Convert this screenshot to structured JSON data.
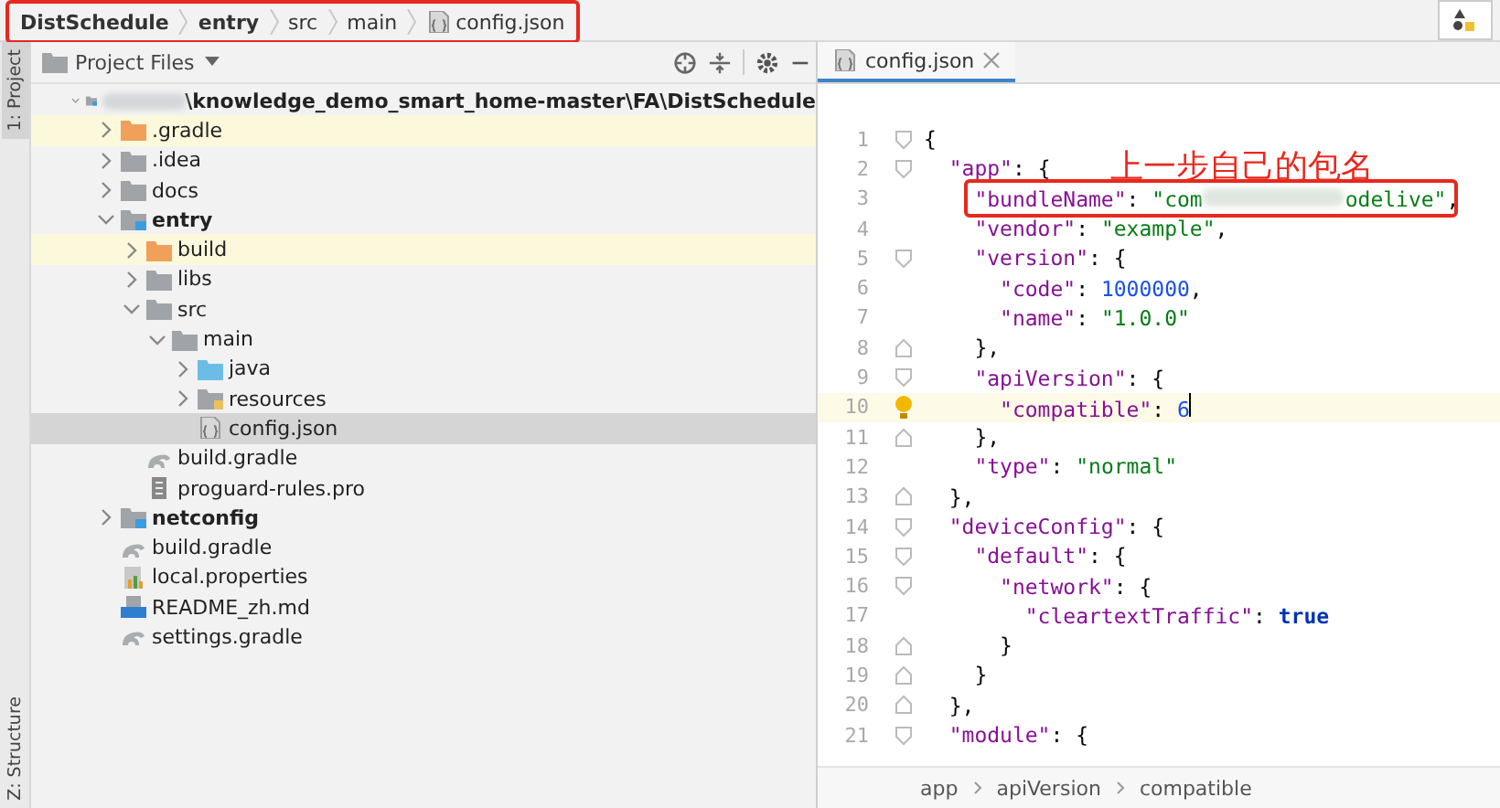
{
  "navbar": {
    "crumbs": [
      {
        "label": "DistSchedule",
        "kind": "module"
      },
      {
        "label": "entry",
        "kind": "module"
      },
      {
        "label": "src",
        "kind": "dir"
      },
      {
        "label": "main",
        "kind": "dir"
      },
      {
        "label": "config.json",
        "kind": "json"
      }
    ]
  },
  "side_tabs": [
    {
      "label": "1: Project",
      "selected": true
    },
    {
      "label": "Z: Structure",
      "selected": false
    }
  ],
  "project": {
    "title": "Project Files",
    "tree": [
      {
        "label": "\\knowledge_demo_smart_home-master\\FA\\DistSchedule",
        "kind": "module",
        "redacted": true,
        "expanded": true,
        "selected": false,
        "highlighted": false,
        "children": [
          {
            "label": ".gradle",
            "kind": "excluded",
            "expanded": false,
            "selected": false,
            "highlighted": true
          },
          {
            "label": ".idea",
            "kind": "folder",
            "expanded": false,
            "selected": false,
            "highlighted": false
          },
          {
            "label": "docs",
            "kind": "folder",
            "expanded": false,
            "selected": false,
            "highlighted": false
          },
          {
            "label": "entry",
            "kind": "module",
            "expanded": true,
            "selected": false,
            "highlighted": false,
            "children": [
              {
                "label": "build",
                "kind": "excluded",
                "expanded": false,
                "selected": false,
                "highlighted": true
              },
              {
                "label": "libs",
                "kind": "folder",
                "expanded": false,
                "selected": false,
                "highlighted": false
              },
              {
                "label": "src",
                "kind": "folder",
                "expanded": true,
                "selected": false,
                "highlighted": false,
                "children": [
                  {
                    "label": "main",
                    "kind": "folder",
                    "expanded": true,
                    "selected": false,
                    "highlighted": false,
                    "children": [
                      {
                        "label": "java",
                        "kind": "source",
                        "expanded": false,
                        "selected": false,
                        "highlighted": false
                      },
                      {
                        "label": "resources",
                        "kind": "resources",
                        "expanded": false,
                        "selected": false,
                        "highlighted": false
                      },
                      {
                        "label": "config.json",
                        "kind": "json",
                        "selected": true,
                        "highlighted": false
                      }
                    ]
                  }
                ]
              },
              {
                "label": "build.gradle",
                "kind": "gradle",
                "selected": false,
                "highlighted": false
              },
              {
                "label": "proguard-rules.pro",
                "kind": "text",
                "selected": false,
                "highlighted": false
              }
            ]
          },
          {
            "label": "netconfig",
            "kind": "module",
            "expanded": false,
            "selected": false,
            "highlighted": false
          },
          {
            "label": "build.gradle",
            "kind": "gradle",
            "selected": false,
            "highlighted": false
          },
          {
            "label": "local.properties",
            "kind": "properties",
            "selected": false,
            "highlighted": false
          },
          {
            "label": "README_zh.md",
            "kind": "markdown",
            "selected": false,
            "highlighted": false
          },
          {
            "label": "settings.gradle",
            "kind": "gradle",
            "selected": false,
            "highlighted": false
          }
        ]
      }
    ]
  },
  "editor": {
    "tabs": [
      {
        "label": "config.json",
        "selected": true
      }
    ],
    "lines": [
      {
        "number": "1",
        "fold_open": true,
        "fold_close": false,
        "current": false,
        "tokens": [
          {
            "kind": "punct",
            "text": "{"
          }
        ]
      },
      {
        "number": "2",
        "fold_open": true,
        "fold_close": false,
        "current": false,
        "tokens": [
          {
            "kind": "key",
            "text": "  \"app\""
          },
          {
            "kind": "punct",
            "text": ": {"
          }
        ]
      },
      {
        "number": "3",
        "fold_open": false,
        "fold_close": false,
        "current": false,
        "tokens": [
          {
            "kind": "key",
            "text": "    \"bundleName\""
          },
          {
            "kind": "punct",
            "text": ": "
          },
          {
            "kind": "str",
            "text": "\"com"
          },
          {
            "kind": "redacted"
          },
          {
            "kind": "str",
            "text": "odelive\""
          },
          {
            "kind": "punct",
            "text": ","
          }
        ]
      },
      {
        "number": "4",
        "fold_open": false,
        "fold_close": false,
        "current": false,
        "tokens": [
          {
            "kind": "key",
            "text": "    \"vendor\""
          },
          {
            "kind": "punct",
            "text": ": "
          },
          {
            "kind": "str",
            "text": "\"example\""
          },
          {
            "kind": "punct",
            "text": ","
          }
        ]
      },
      {
        "number": "5",
        "fold_open": true,
        "fold_close": false,
        "current": false,
        "tokens": [
          {
            "kind": "key",
            "text": "    \"version\""
          },
          {
            "kind": "punct",
            "text": ": {"
          }
        ]
      },
      {
        "number": "6",
        "fold_open": false,
        "fold_close": false,
        "current": false,
        "tokens": [
          {
            "kind": "key",
            "text": "      \"code\""
          },
          {
            "kind": "punct",
            "text": ": "
          },
          {
            "kind": "num",
            "text": "1000000"
          },
          {
            "kind": "punct",
            "text": ","
          }
        ]
      },
      {
        "number": "7",
        "fold_open": false,
        "fold_close": false,
        "current": false,
        "tokens": [
          {
            "kind": "key",
            "text": "      \"name\""
          },
          {
            "kind": "punct",
            "text": ": "
          },
          {
            "kind": "str",
            "text": "\"1.0.0\""
          }
        ]
      },
      {
        "number": "8",
        "fold_open": false,
        "fold_close": true,
        "current": false,
        "tokens": [
          {
            "kind": "punct",
            "text": "    },"
          }
        ]
      },
      {
        "number": "9",
        "fold_open": true,
        "fold_close": false,
        "current": false,
        "tokens": [
          {
            "kind": "key",
            "text": "    \"apiVersion\""
          },
          {
            "kind": "punct",
            "text": ": {"
          }
        ]
      },
      {
        "number": "10",
        "fold_open": false,
        "fold_close": false,
        "current": true,
        "tokens": [
          {
            "kind": "key",
            "text": "      \"compatible\""
          },
          {
            "kind": "punct",
            "text": ": "
          },
          {
            "kind": "num",
            "text": "6"
          }
        ]
      },
      {
        "number": "11",
        "fold_open": false,
        "fold_close": true,
        "current": false,
        "tokens": [
          {
            "kind": "punct",
            "text": "    },"
          }
        ]
      },
      {
        "number": "12",
        "fold_open": false,
        "fold_close": false,
        "current": false,
        "tokens": [
          {
            "kind": "key",
            "text": "    \"type\""
          },
          {
            "kind": "punct",
            "text": ": "
          },
          {
            "kind": "str",
            "text": "\"normal\""
          }
        ]
      },
      {
        "number": "13",
        "fold_open": false,
        "fold_close": true,
        "current": false,
        "tokens": [
          {
            "kind": "punct",
            "text": "  },"
          }
        ]
      },
      {
        "number": "14",
        "fold_open": true,
        "fold_close": false,
        "current": false,
        "tokens": [
          {
            "kind": "key",
            "text": "  \"deviceConfig\""
          },
          {
            "kind": "punct",
            "text": ": {"
          }
        ]
      },
      {
        "number": "15",
        "fold_open": true,
        "fold_close": false,
        "current": false,
        "tokens": [
          {
            "kind": "key",
            "text": "    \"default\""
          },
          {
            "kind": "punct",
            "text": ": {"
          }
        ]
      },
      {
        "number": "16",
        "fold_open": true,
        "fold_close": false,
        "current": false,
        "tokens": [
          {
            "kind": "key",
            "text": "      \"network\""
          },
          {
            "kind": "punct",
            "text": ": {"
          }
        ]
      },
      {
        "number": "17",
        "fold_open": false,
        "fold_close": false,
        "current": false,
        "tokens": [
          {
            "kind": "key",
            "text": "        \"cleartextTraffic\""
          },
          {
            "kind": "punct",
            "text": ": "
          },
          {
            "kind": "kw",
            "text": "true"
          }
        ]
      },
      {
        "number": "18",
        "fold_open": false,
        "fold_close": true,
        "current": false,
        "tokens": [
          {
            "kind": "punct",
            "text": "      }"
          }
        ]
      },
      {
        "number": "19",
        "fold_open": false,
        "fold_close": true,
        "current": false,
        "tokens": [
          {
            "kind": "punct",
            "text": "    }"
          }
        ]
      },
      {
        "number": "20",
        "fold_open": false,
        "fold_close": true,
        "current": false,
        "tokens": [
          {
            "kind": "punct",
            "text": "  },"
          }
        ]
      },
      {
        "number": "21",
        "fold_open": true,
        "fold_close": false,
        "current": false,
        "tokens": [
          {
            "kind": "key",
            "text": "  \"module\""
          },
          {
            "kind": "punct",
            "text": ": {"
          }
        ]
      }
    ],
    "annotation": {
      "text": "上一步自己的包名"
    },
    "breadcrumbs": [
      "app",
      "apiVersion",
      "compatible"
    ]
  }
}
